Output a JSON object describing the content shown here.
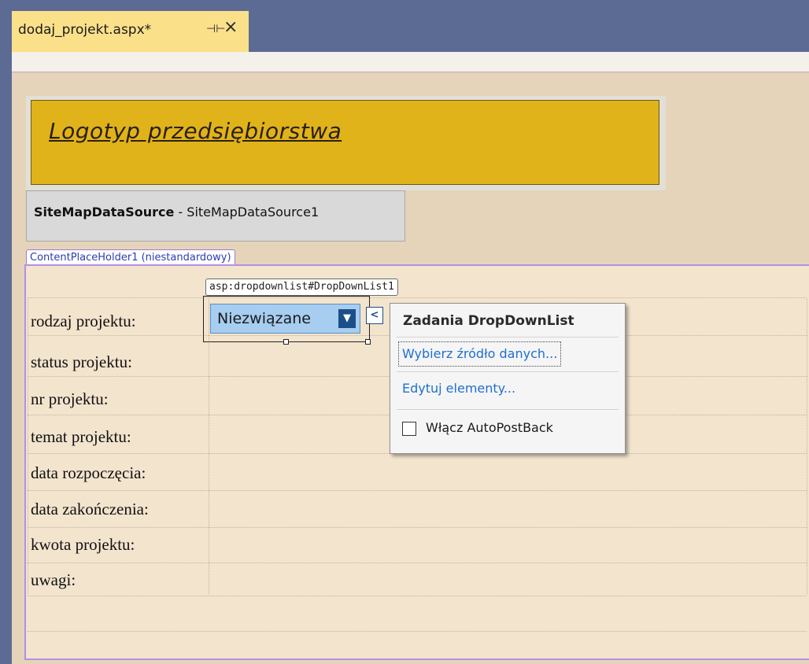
{
  "tab": {
    "title": "dodaj_projekt.aspx*",
    "pin_icon": "pin-icon",
    "close_icon": "close-icon"
  },
  "logo": {
    "text": "Logotyp przedsiębiorstwa"
  },
  "sitemap": {
    "name": "SiteMapDataSource",
    "separator": " - ",
    "id": "SiteMapDataSource1"
  },
  "content_placeholder": {
    "label": "ContentPlaceHolder1 (niestandardowy)"
  },
  "dropdown": {
    "tag": "asp:dropdownlist#DropDownList1",
    "value": "Niezwiązane",
    "arrow": "▼",
    "smart_tag": "<"
  },
  "tasks": {
    "title": "Zadania DropDownList",
    "choose_datasource": "Wybierz źródło danych...",
    "edit_items": "Edytuj elementy...",
    "autopostback": {
      "label": "Włącz AutoPostBack",
      "checked": false
    }
  },
  "form": {
    "labels": [
      "rodzaj projektu:",
      "status projektu:",
      "nr projektu:",
      "temat projektu:",
      "data rozpoczęcia:",
      "data zakończenia:",
      "kwota projektu:",
      "uwagi:"
    ]
  },
  "colors": {
    "tabbar": "#5c6b94",
    "active_tab": "#fbe08a",
    "design_surface": "#e5d4b9",
    "logo_bg": "#e1b31a",
    "placeholder_border": "#b68ee6",
    "dropdown_bg": "#a7cdf0",
    "link": "#1f6fd1"
  }
}
